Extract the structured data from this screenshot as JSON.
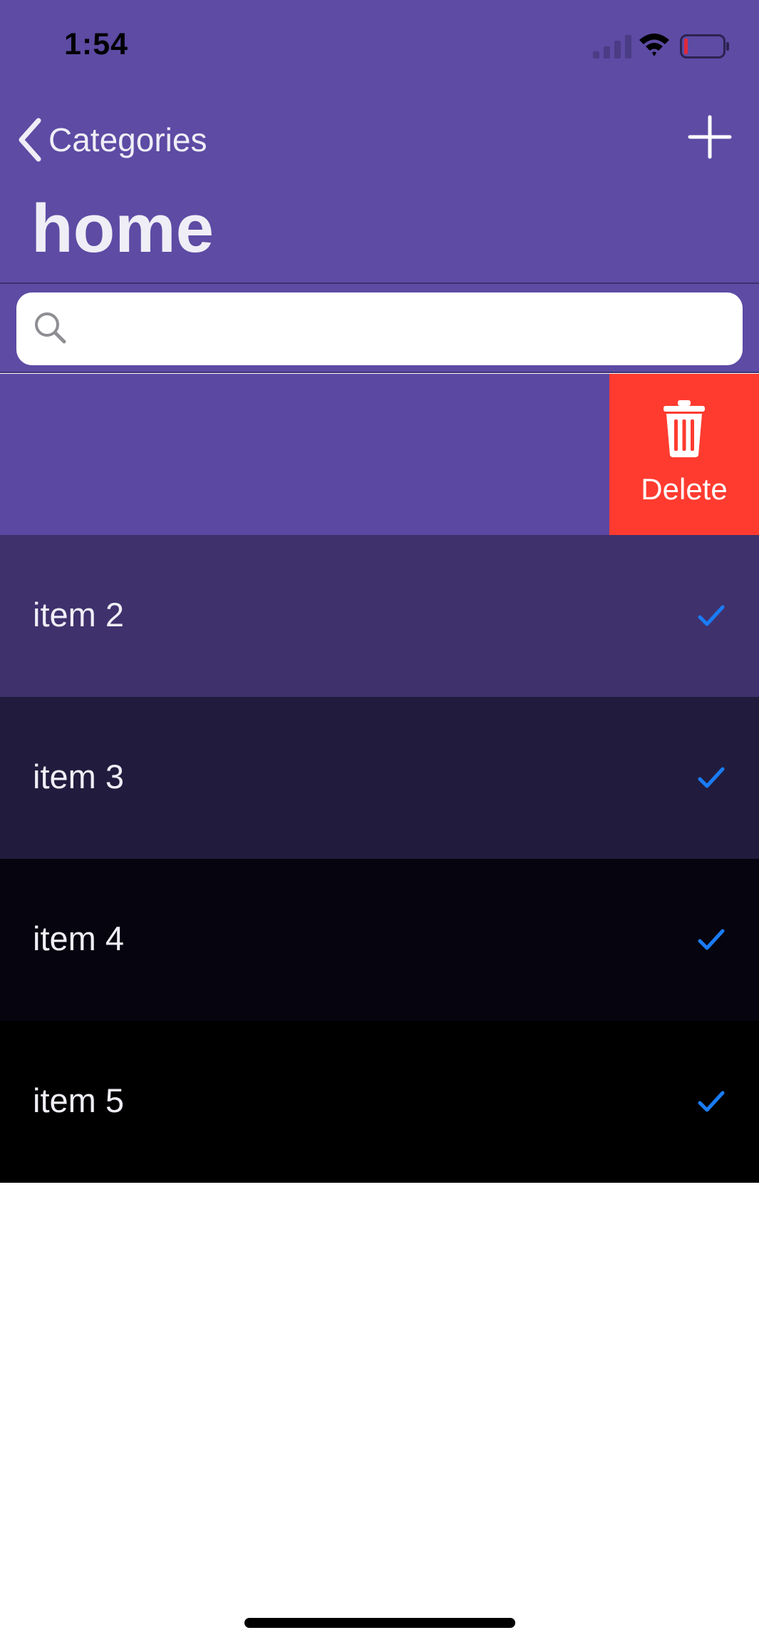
{
  "status_bar": {
    "time": "1:54"
  },
  "nav": {
    "back_label": "Categories",
    "title": "home"
  },
  "search": {
    "placeholder": "",
    "value": ""
  },
  "swipe_action": {
    "delete_label": "Delete",
    "color": "#ff3b30"
  },
  "items": [
    {
      "label": "item 2",
      "checked": true,
      "bg": "#3f316c"
    },
    {
      "label": "item 3",
      "checked": true,
      "bg": "#211c3d"
    },
    {
      "label": "item 4",
      "checked": true,
      "bg": "#06040e"
    },
    {
      "label": "item 5",
      "checked": true,
      "bg": "#000000"
    }
  ],
  "colors": {
    "header": "#5d4ba4",
    "checkmark": "#1a7cf5",
    "text": "#efeef6"
  },
  "icons": {
    "back": "chevron-left-icon",
    "add": "plus-icon",
    "search": "magnifier-icon",
    "trash": "trash-icon",
    "check": "checkmark-icon"
  }
}
